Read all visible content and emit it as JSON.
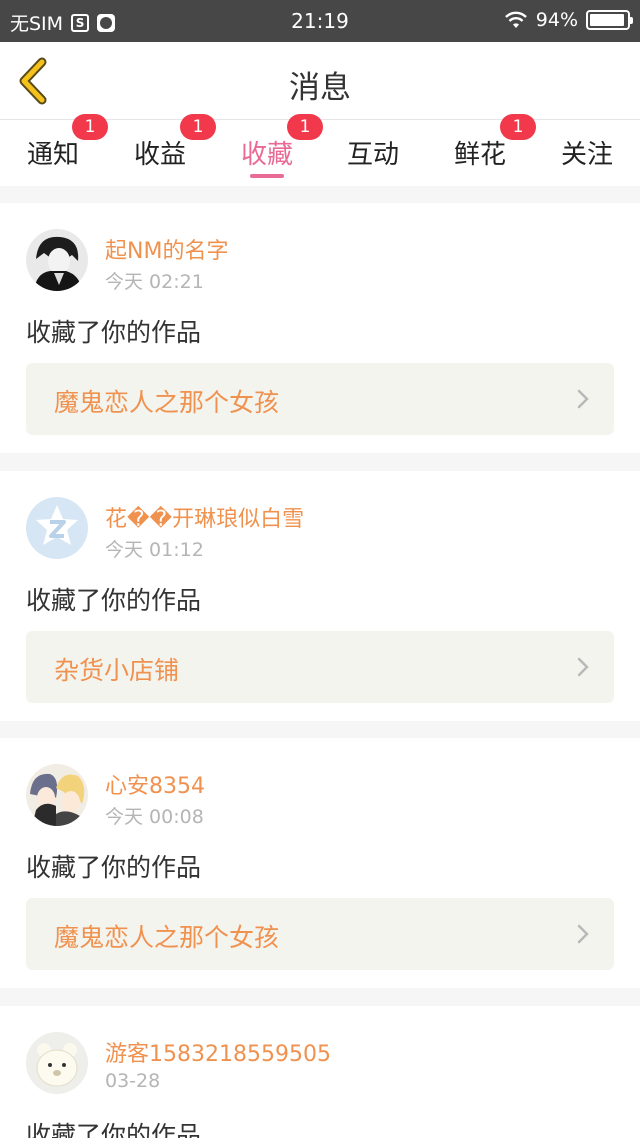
{
  "status_bar": {
    "carrier": "无SIM",
    "time": "21:19",
    "battery": "94%"
  },
  "header": {
    "title": "消息"
  },
  "tabs": [
    {
      "label": "通知",
      "badge": "1"
    },
    {
      "label": "收益",
      "badge": "1"
    },
    {
      "label": "收藏",
      "badge": "1",
      "active": true
    },
    {
      "label": "互动",
      "badge": ""
    },
    {
      "label": "鲜花",
      "badge": "1"
    },
    {
      "label": "关注",
      "badge": ""
    }
  ],
  "messages": [
    {
      "user": "起NM的名字",
      "time": "今天 02:21",
      "action": "收藏了你的作品",
      "work": "魔鬼恋人之那个女孩"
    },
    {
      "user": "花��开琳琅似白雪",
      "time": "今天 01:12",
      "action": "收藏了你的作品",
      "work": "杂货小店铺"
    },
    {
      "user": "心安8354",
      "time": "今天 00:08",
      "action": "收藏了你的作品",
      "work": "魔鬼恋人之那个女孩"
    },
    {
      "user": "游客1583218559505",
      "time": "03-28",
      "action": "收藏了你的作品",
      "work": ""
    }
  ],
  "colors": {
    "accent": "#e86a95",
    "username": "#f0924f",
    "badge": "#f2384b",
    "back_arrow": "#f4c21b"
  }
}
